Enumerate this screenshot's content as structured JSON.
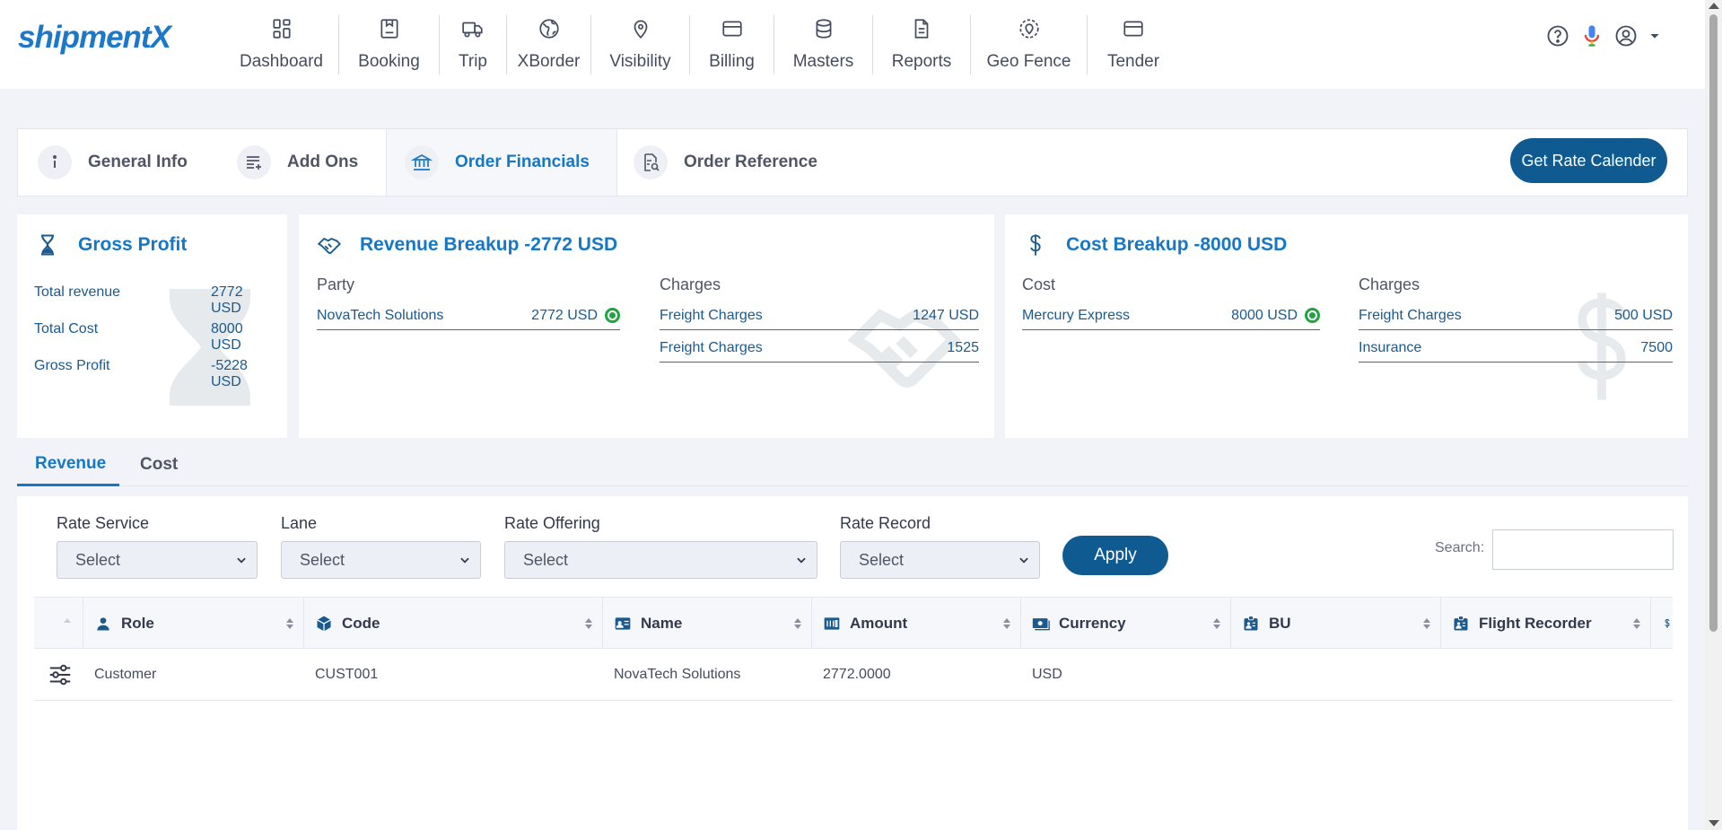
{
  "app": {
    "logo_text": "shipmentX"
  },
  "nav": {
    "items": [
      {
        "label": "Dashboard",
        "icon": "dashboard-icon"
      },
      {
        "label": "Booking",
        "icon": "booking-icon"
      },
      {
        "label": "Trip",
        "icon": "truck-icon"
      },
      {
        "label": "XBorder",
        "icon": "globe-icon"
      },
      {
        "label": "Visibility",
        "icon": "location-pin-icon"
      },
      {
        "label": "Billing",
        "icon": "card-icon"
      },
      {
        "label": "Masters",
        "icon": "database-icon"
      },
      {
        "label": "Reports",
        "icon": "document-icon"
      },
      {
        "label": "Geo Fence",
        "icon": "geofence-icon"
      },
      {
        "label": "Tender",
        "icon": "tender-icon"
      }
    ]
  },
  "section_tabs": [
    {
      "label": "General Info",
      "icon": "info-icon"
    },
    {
      "label": "Add Ons",
      "icon": "list-add-icon"
    },
    {
      "label": "Order Financials",
      "icon": "bank-icon",
      "active": true
    },
    {
      "label": "Order Reference",
      "icon": "doc-search-icon"
    }
  ],
  "rate_calendar_label": "Get Rate Calender",
  "gross_profit": {
    "title": "Gross Profit",
    "rows": [
      {
        "label": "Total revenue",
        "value": "2772 USD"
      },
      {
        "label": "Total Cost",
        "value": "8000 USD"
      },
      {
        "label": "Gross Profit",
        "value": "-5228 USD"
      }
    ]
  },
  "revenue_breakup": {
    "title": "Revenue Breakup -2772 USD",
    "party_header": "Party",
    "charges_header": "Charges",
    "party": {
      "name": "NovaTech Solutions",
      "amount": "2772 USD"
    },
    "charges": [
      {
        "name": "Freight Charges",
        "amount": "1247 USD"
      },
      {
        "name": "Freight Charges",
        "amount": "1525"
      }
    ]
  },
  "cost_breakup": {
    "title": "Cost Breakup -8000 USD",
    "cost_header": "Cost",
    "charges_header": "Charges",
    "party": {
      "name": "Mercury Express",
      "amount": "8000 USD"
    },
    "charges": [
      {
        "name": "Freight Charges",
        "amount": "500 USD"
      },
      {
        "name": "Insurance",
        "amount": "7500"
      }
    ]
  },
  "rc_tabs": [
    {
      "label": "Revenue",
      "active": true
    },
    {
      "label": "Cost"
    }
  ],
  "filters": [
    {
      "label": "Rate Service",
      "value": "Select"
    },
    {
      "label": "Lane",
      "value": "Select"
    },
    {
      "label": "Rate Offering",
      "value": "Select"
    },
    {
      "label": "Rate Record",
      "value": "Select"
    }
  ],
  "apply_label": "Apply",
  "search_label": "Search:",
  "table": {
    "columns": [
      "Role",
      "Code",
      "Name",
      "Amount",
      "Currency",
      "BU",
      "Flight Recorder"
    ],
    "rows": [
      {
        "role": "Customer",
        "code": "CUST001",
        "name": "NovaTech Solutions",
        "amount": "2772.0000",
        "currency": "USD",
        "bu": "",
        "flight_recorder": ""
      }
    ]
  },
  "colors": {
    "accent": "#1677c5",
    "button": "#0e5a91",
    "status_ok": "#21a344"
  }
}
